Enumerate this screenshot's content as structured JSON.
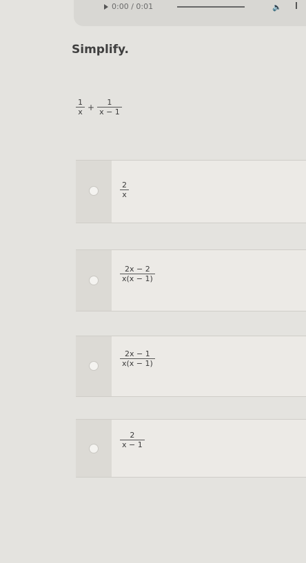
{
  "audio": {
    "time": "0:00 / 0:01"
  },
  "question": {
    "instruction": "Simplify.",
    "term1_num": "1",
    "term1_den": "x",
    "operator": "+",
    "term2_num": "1",
    "term2_den": "x − 1"
  },
  "options": [
    {
      "num": "2",
      "den": "x"
    },
    {
      "num": "2x − 2",
      "den": "x(x − 1)"
    },
    {
      "num": "2x − 1",
      "den": "x(x − 1)"
    },
    {
      "num": "2",
      "den": "x − 1"
    }
  ]
}
